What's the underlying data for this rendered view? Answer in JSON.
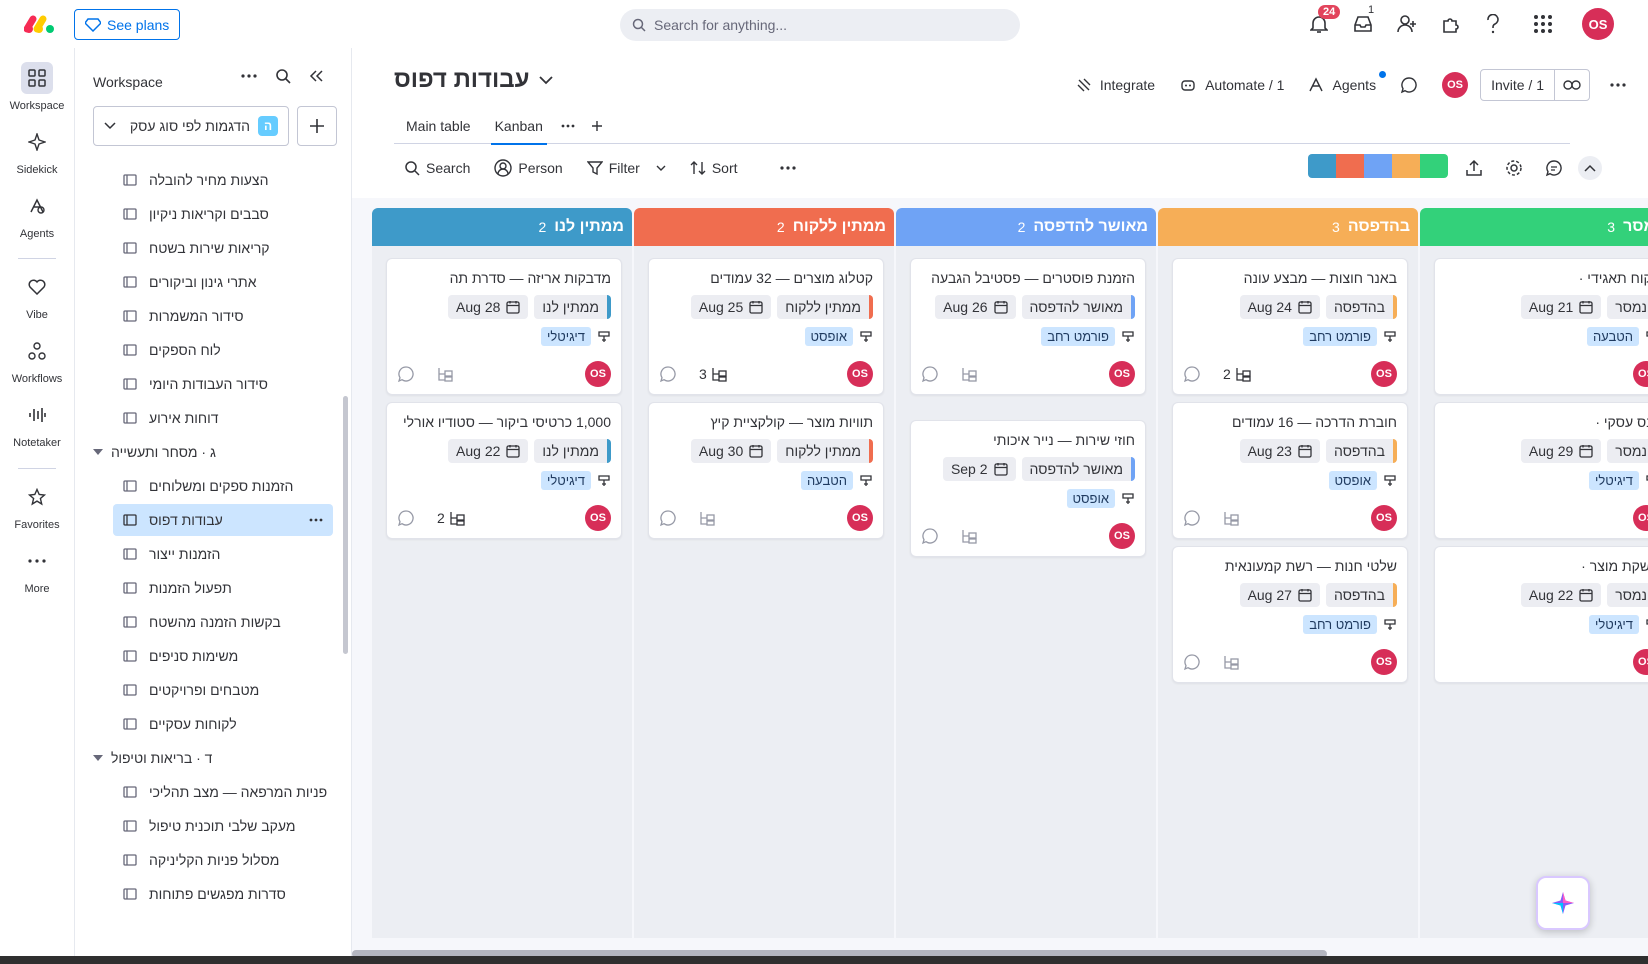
{
  "topbar": {
    "see_plans": "See plans",
    "search_placeholder": "Search for anything...",
    "notifications_count": "24",
    "inbox_count": "1",
    "avatar": "OS"
  },
  "rail": {
    "items": [
      {
        "label": "Workspace",
        "icon": "grid-icon"
      },
      {
        "label": "Sidekick",
        "icon": "sparkle-icon"
      },
      {
        "label": "Agents",
        "icon": "agents-icon"
      },
      {
        "label": "Vibe",
        "icon": "heart-icon"
      },
      {
        "label": "Workflows",
        "icon": "workflows-icon"
      },
      {
        "label": "Notetaker",
        "icon": "waveform-icon"
      },
      {
        "label": "Favorites",
        "icon": "star-icon"
      },
      {
        "label": "More",
        "icon": "dots-icon"
      }
    ]
  },
  "sidebar": {
    "title": "Workspace",
    "workspace_badge": "ה",
    "workspace_name": "הדגמות לפי סוג עסק",
    "items": [
      "הצעות מחיר להובלה",
      "סבבים וקריאות ניקיון",
      "קריאות שירות בשטח",
      "אתרי גינון וביקורים",
      "סידור המשמרות",
      "לוח הספקים",
      "סידור העבודות היומי",
      "דוחות אירוע"
    ],
    "folder_g": "ג · מסחר ותעשייה",
    "items_g": [
      "הזמנות ספקים ומשלוחים",
      "עבודות דפוס",
      "הזמנות ייצור",
      "תפעול הזמנות",
      "בקשות הזמנה מהשטח",
      "משימות סניפים",
      "מטבחים ופרויקטים",
      "לקוחות עסקיים"
    ],
    "folder_d": "ד · בריאות וטיפול",
    "items_d": [
      "פניות המרפאה — מצב תהליכי",
      "מעקב שלבי תוכנית טיפול",
      "מסלול פניות הקליניקה",
      "סדרות מפגשים פתוחות"
    ]
  },
  "header": {
    "board_title": "עבודות דפוס",
    "integrate": "Integrate",
    "automate": "Automate / 1",
    "agents": "Agents",
    "avatar": "OS",
    "invite": "Invite / 1"
  },
  "tabs": [
    "Main table",
    "Kanban"
  ],
  "toolbar": {
    "search": "Search",
    "person": "Person",
    "filter": "Filter",
    "sort": "Sort"
  },
  "colors": {
    "waiting_us": "#3e9ac9",
    "waiting_client": "#f06d4f",
    "approved": "#6fa3f5",
    "printing": "#f6ae57",
    "delivered": "#33d17a"
  },
  "columns": [
    {
      "name": "ממתין לנו",
      "count": "2",
      "color": "#3e9ac9",
      "cards": [
        {
          "title": "מדבקות אריזה — סדרת תה",
          "status": "ממתין לנו",
          "date": "28 Aug",
          "tag": "דיגיטלי",
          "avatar": "OS",
          "subitems": ""
        },
        {
          "title": "1,000 כרטיסי ביקור — סטודיו אורלי",
          "status": "ממתין לנו",
          "date": "22 Aug",
          "tag": "דיגיטלי",
          "avatar": "OS",
          "subitems": "2"
        }
      ]
    },
    {
      "name": "ממתין ללקוח",
      "count": "2",
      "color": "#f06d4f",
      "cards": [
        {
          "title": "קטלוג מוצרים — 32 עמודים",
          "status": "ממתין ללקוח",
          "date": "25 Aug",
          "tag": "אופסט",
          "avatar": "OS",
          "subitems": "3"
        },
        {
          "title": "תוויות מוצר — קולקציית קיץ",
          "status": "ממתין ללקוח",
          "date": "30 Aug",
          "tag": "הטבעה",
          "avatar": "OS",
          "subitems": ""
        }
      ]
    },
    {
      "name": "מאושר להדפסה",
      "count": "2",
      "color": "#6fa3f5",
      "cards": [
        {
          "title": "הזמנת פוסטרים — פסטיבל הגבעה",
          "status": "מאושר להדפסה",
          "date": "26 Aug",
          "tag": "פורמט רחב",
          "avatar": "OS",
          "subitems": ""
        },
        {
          "title": "חוזי שירות — נייר איכותי",
          "status": "מאושר להדפסה",
          "date": "2 Sep",
          "tag": "אופסט",
          "avatar": "OS",
          "subitems": ""
        }
      ]
    },
    {
      "name": "בהדפסה",
      "count": "3",
      "color": "#f6ae57",
      "cards": [
        {
          "title": "באנר חוצות — מבצע עונה",
          "status": "בהדפסה",
          "date": "24 Aug",
          "tag": "פורמט רחב",
          "avatar": "OS",
          "subitems": "2"
        },
        {
          "title": "חוברת הדרכה — 16 עמודים",
          "status": "בהדפסה",
          "date": "23 Aug",
          "tag": "אופסט",
          "avatar": "OS",
          "subitems": ""
        },
        {
          "title": "שלטי חנות — רשת קמעונאית",
          "status": "בהדפסה",
          "date": "27 Aug",
          "tag": "פורמט רחב",
          "avatar": "OS",
          "subitems": ""
        }
      ]
    },
    {
      "name": "נמסר",
      "count": "3",
      "color": "#33d17a",
      "cards": [
        {
          "title": "לקוח תאגידי ·",
          "status": "נמסר",
          "date": "21 Aug",
          "tag": "הטבעה",
          "avatar": "OS",
          "subitems": ""
        },
        {
          "title": "כנס עסקי ·",
          "status": "נמסר",
          "date": "29 Aug",
          "tag": "דיגיטלי",
          "avatar": "OS",
          "subitems": ""
        },
        {
          "title": "השקת מוצר ·",
          "status": "נמסר",
          "date": "22 Aug",
          "tag": "דיגיטלי",
          "avatar": "OS",
          "subitems": ""
        }
      ]
    }
  ]
}
